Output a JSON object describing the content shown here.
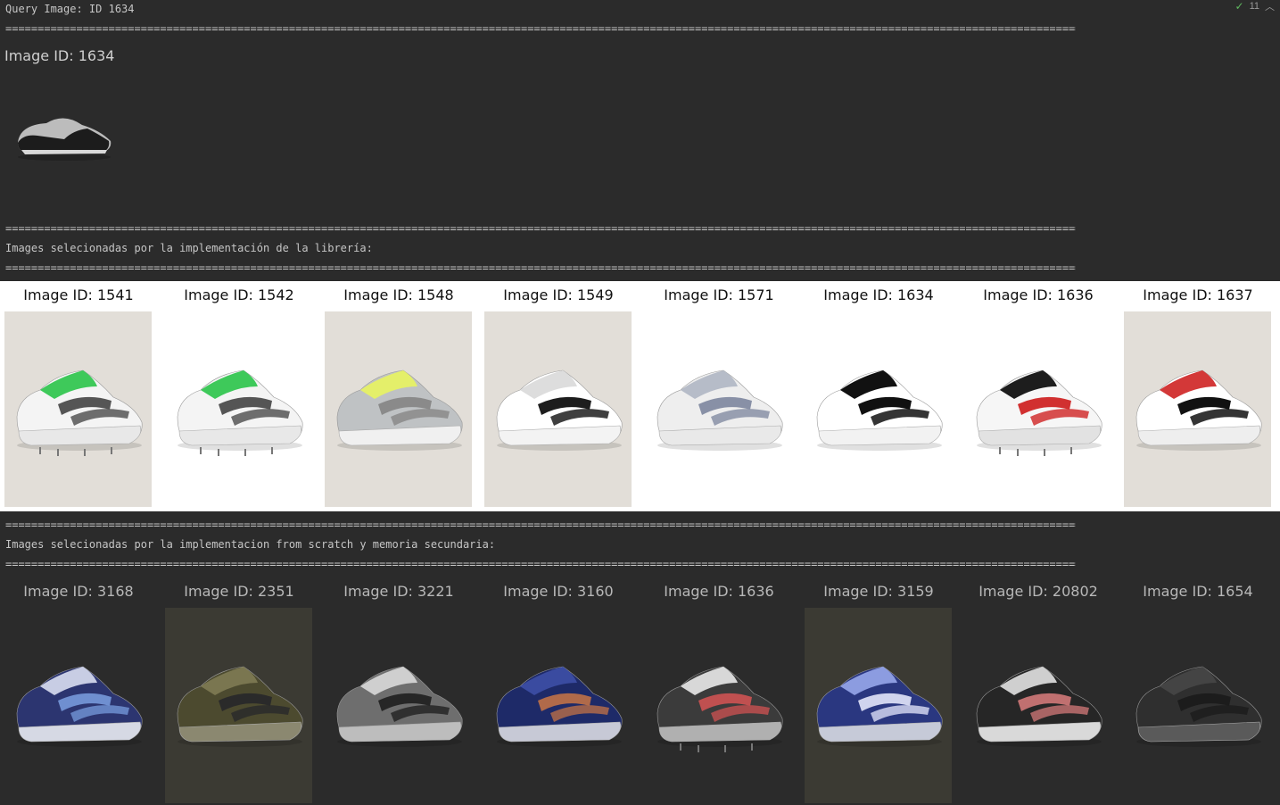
{
  "console": {
    "header": "Query Image: ID 1634",
    "separator": "============================================================================================================================================================================================================================================",
    "section1_title": "Images selecionadas por la implementación de la librería:",
    "section2_title": "Images selecionadas por la implementacion from scratch y memoria secundaria:",
    "indicator_count": "11"
  },
  "query": {
    "title": "Image ID: 1634",
    "thumb": {
      "kind": "saddle",
      "bg": "#2b2b2b"
    }
  },
  "library_results": [
    {
      "label": "Image ID: 1541",
      "kind": "green-puma",
      "bg": "#e2ded8"
    },
    {
      "label": "Image ID: 1542",
      "kind": "green-puma",
      "bg": "#ffffff"
    },
    {
      "label": "Image ID: 1548",
      "kind": "yellow-runner",
      "bg": "#e2ded8"
    },
    {
      "label": "Image ID: 1549",
      "kind": "white-puma",
      "bg": "#e2ded8"
    },
    {
      "label": "Image ID: 1571",
      "kind": "white-runner",
      "bg": "#ffffff"
    },
    {
      "label": "Image ID: 1634",
      "kind": "saddle",
      "bg": "#ffffff"
    },
    {
      "label": "Image ID: 1636",
      "kind": "white-black-spike",
      "bg": "#ffffff"
    },
    {
      "label": "Image ID: 1637",
      "kind": "red-stripe",
      "bg": "#e2ded8"
    }
  ],
  "scratch_results": [
    {
      "label": "Image ID: 3168",
      "kind": "navy-runner",
      "bg": "#2b2b2b"
    },
    {
      "label": "Image ID: 2351",
      "kind": "olive-runner",
      "bg": "#3b3a33"
    },
    {
      "label": "Image ID: 3221",
      "kind": "grey-puma",
      "bg": "#2b2b2b"
    },
    {
      "label": "Image ID: 3160",
      "kind": "navy-nike",
      "bg": "#2b2b2b"
    },
    {
      "label": "Image ID: 1636",
      "kind": "dark-spike",
      "bg": "#2b2b2b"
    },
    {
      "label": "Image ID: 3159",
      "kind": "blue-nike",
      "bg": "#3b3a33"
    },
    {
      "label": "Image ID: 20802",
      "kind": "fila",
      "bg": "#2b2b2b"
    },
    {
      "label": "Image ID: 1654",
      "kind": "dark-reebok",
      "bg": "#2b2b2b"
    }
  ],
  "icons": {
    "indicator": "check-icon",
    "collapse": "chevron-up-icon"
  }
}
